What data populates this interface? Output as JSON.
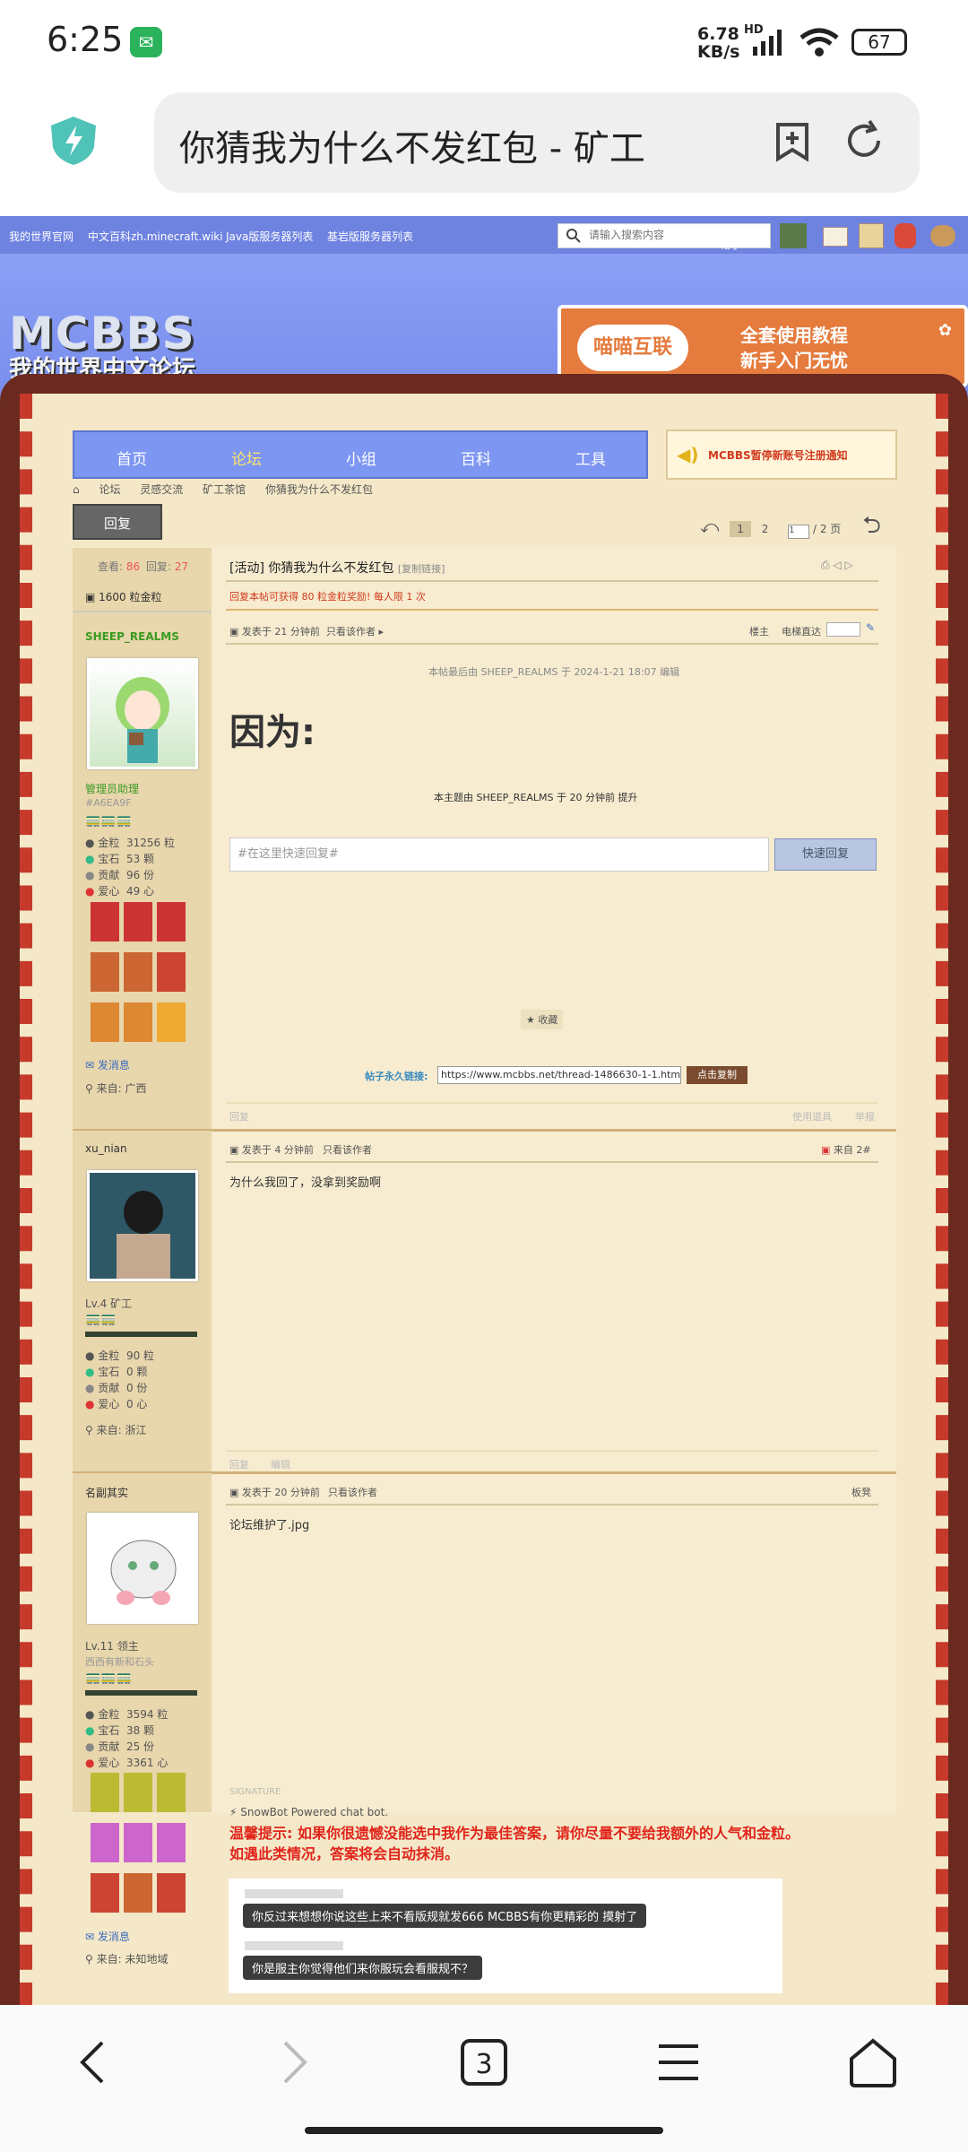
{
  "status_bar": {
    "time": "6:25",
    "net_speed_line1": "6.78",
    "net_speed_line2": "KB/s",
    "network": "HD",
    "battery": "67"
  },
  "browser": {
    "url_title": "你猜我为什么不发红包 - 矿工"
  },
  "site": {
    "top_links": [
      "我的世界官网",
      "中文百科zh.minecraft.wiki",
      "Java版服务器列表",
      "基岩版服务器列表"
    ],
    "search_placeholder": "请输入搜索内容",
    "search_type": "帖子",
    "logo_line1": "MCBBS",
    "logo_line2": "我的世界中文论坛",
    "promo_pill": "喵喵互联",
    "promo_line1": "全套使用教程",
    "promo_line2": "新手入门无忧",
    "main_nav": [
      "首页",
      "论坛",
      "小组",
      "百科",
      "工具"
    ],
    "notice": "MCBBS暂停新账号注册通知",
    "breadcrumb": [
      "论坛",
      "灵感交流",
      "矿工茶馆",
      "你猜我为什么不发红包"
    ],
    "reply_button": "回复",
    "pager": {
      "current": "1",
      "next": "2",
      "input": "1",
      "total": "/ 2 页"
    }
  },
  "thread": {
    "views_label": "查看:",
    "views": "86",
    "replies_label": "回复:",
    "replies": "27",
    "reward": "1600 粒金粒",
    "title": "[活动] 你猜我为什么不发红包",
    "copy_link": "[复制链接]",
    "reward_notice": "回复本帖可获得 80 粒金粒奖励! 每人限 1 次",
    "edit_note": "本帖最后由 SHEEP_REALMS 于 2024-1-21 18:07 编辑",
    "body": "因为:",
    "bump_note": "本主题由 SHEEP_REALMS 于 20 分钟前 提升",
    "quick_reply_placeholder": "#在这里快速回复#",
    "quick_reply_button": "快速回复",
    "favorite": "收藏",
    "permalink_label": "帖子永久链接:",
    "permalink": "https://www.mcbbs.net/thread-1486630-1-1.html",
    "copy_button": "点击复制"
  },
  "posts": [
    {
      "author": "SHEEP_REALMS",
      "group": "管理员助理",
      "color_code": "#A6EA9F",
      "stats": [
        [
          "金粒",
          "31256 粒"
        ],
        [
          "宝石",
          "53 颗"
        ],
        [
          "贡献",
          "96 份"
        ],
        [
          "爱心",
          "49 心"
        ]
      ],
      "message": "发消息",
      "location": "来自: 广西",
      "time": "发表于 21 分钟前",
      "only_author": "只看该作者",
      "floor": "楼主",
      "elevator": "电梯直达",
      "reply": "回复",
      "report": "举报",
      "use_item": "使用道具"
    },
    {
      "author": "xu_nian",
      "level": "Lv.4 矿工",
      "stats": [
        [
          "金粒",
          "90 粒"
        ],
        [
          "宝石",
          "0 颗"
        ],
        [
          "贡献",
          "0 份"
        ],
        [
          "爱心",
          "0 心"
        ]
      ],
      "location": "来自: 浙江",
      "time": "发表于 4 分钟前",
      "only_author": "只看该作者",
      "floor": "来自 2#",
      "content": "为什么我回了，没拿到奖励啊",
      "reply": "回复",
      "edit": "编辑"
    },
    {
      "author": "名副其实",
      "level": "Lv.11 领主",
      "subtitle": "西西有新和石头",
      "stats": [
        [
          "金粒",
          "3594 粒"
        ],
        [
          "宝石",
          "38 颗"
        ],
        [
          "贡献",
          "25 份"
        ],
        [
          "爱心",
          "3361 心"
        ]
      ],
      "message": "发消息",
      "location": "来自: 未知地域",
      "time": "发表于 20 分钟前",
      "only_author": "只看该作者",
      "floor": "板凳",
      "content": "论坛维护了.jpg",
      "signature_label": "SIGNATURE",
      "signature_line": "SnowBot Powered chat bot.",
      "warning1": "温馨提示: 如果你很遗憾没能选中我作为最佳答案，请你尽量不要给我额外的人气和金粒。",
      "warning2": "如遇此类情况，答案将会自动抹消。",
      "chat1": "你反过来想想你说这些上来不看版规就发666 MCBBS有你更精彩的 摸射了",
      "chat2": "你是服主你觉得他们来你服玩会看服规不？"
    }
  ],
  "colors": {
    "nav_blue": "#7d96f2",
    "frame_brown": "#6b2a20",
    "paper": "#f7ecd0",
    "sidebar": "#e8d6ac",
    "red_text": "#d13a1e",
    "green_name": "#3a9b22"
  }
}
